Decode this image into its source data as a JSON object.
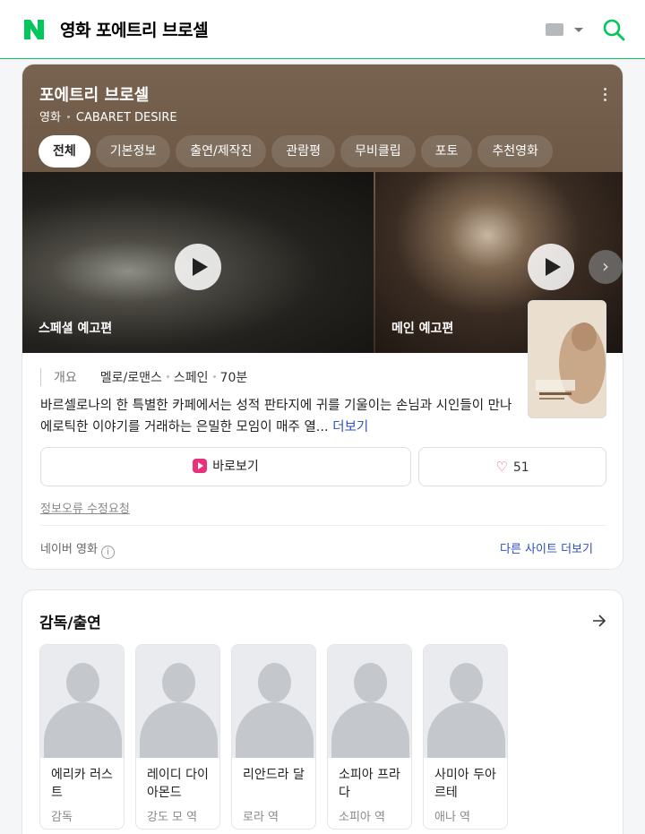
{
  "header": {
    "logo_icon": "naver-n-logo",
    "query": "영화 포에트리 브로셀",
    "keyboard_icon": "keyboard-icon",
    "search_icon": "search-icon",
    "accent_color": "#03c75a"
  },
  "movie": {
    "title": "포에트리 브로셀",
    "category": "영화",
    "original_title": "CABARET DESIRE",
    "tabs": [
      "전체",
      "기본정보",
      "출연/제작진",
      "관람평",
      "무비클립",
      "포토",
      "추천영화"
    ],
    "active_tab": "전체",
    "videos": [
      {
        "label": "스페셜 예고편"
      },
      {
        "label": "메인 예고편"
      }
    ],
    "poster_icon": "movie-poster",
    "overview_label": "개요",
    "genre": "멜로/로맨스",
    "country": "스페인",
    "runtime": "70분",
    "synopsis": "바르셀로나의 한 특별한 카페에서는 성적 판타지에 귀를 기울이는 손님과 시인들이 만나 에로틱한 이야기를 거래하는 은밀한 모임이 매주 열...",
    "more_link": "더보기",
    "watch_label": "바로보기",
    "like_count": "51",
    "report_label": "정보오류 수정요청",
    "source_label": "네이버 영화",
    "other_sites_label": "다른 사이트 더보기"
  },
  "cast": {
    "title": "감독/출연",
    "people": [
      {
        "name": "에리카 러스트",
        "role": "감독"
      },
      {
        "name": "레이디 다이아몬드",
        "role": "강도 모 역"
      },
      {
        "name": "리안드라 달",
        "role": "로라 역"
      },
      {
        "name": "소피아 프라다",
        "role": "소피아 역"
      },
      {
        "name": "사미아 두아르테",
        "role": "애나 역"
      }
    ]
  }
}
